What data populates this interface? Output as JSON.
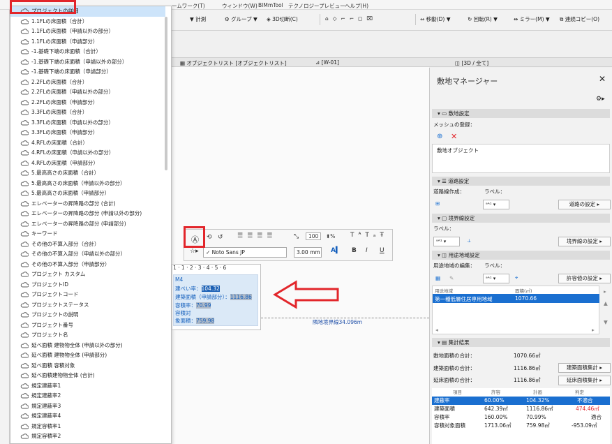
{
  "menu": {
    "items": [
      "ームワーク(T)",
      "ウィンドウ(W)",
      "BIMmTool",
      "テクノロジープレビュー",
      "ヘルプ(H)"
    ]
  },
  "toolbar": {
    "calc": "計測",
    "group": "グループ",
    "view3d": "3D切断(C)",
    "move": "移動(D)",
    "rotate": "回転(R)",
    "mirror": "ミラー(M)",
    "multi_copy": "連続コピー(O)"
  },
  "tabs": {
    "object_list": "オブジェクトリスト [オブジェクトリスト]",
    "w01": "[W-01]",
    "view3d": "[3D / 全て]"
  },
  "dropdown": {
    "items": [
      "プロジェクトの詳細",
      "1.1FLの床面積（合計）",
      "1.1FLの床面積（申請以外の部分）",
      "1.1FLの床面積（申請部分）",
      "-1.基礎下端の床面積（合計）",
      "-1.基礎下端の床面積（申請以外の部分）",
      "-1.基礎下端の床面積（申請部分）",
      "2.2FLの床面積（合計）",
      "2.2FLの床面積（申請以外の部分）",
      "2.2FLの床面積（申請部分）",
      "3.3FLの床面積（合計）",
      "3.3FLの床面積（申請以外の部分）",
      "3.3FLの床面積（申請部分）",
      "4.RFLの床面積（合計）",
      "4.RFLの床面積（申請以外の部分）",
      "4.RFLの床面積（申請部分）",
      "5.最高高さの床面積（合計）",
      "5.最高高さの床面積（申請以外の部分）",
      "5.最高高さの床面積（申請部分）",
      "エレベーターの昇降路の部分 (合計)",
      "エレベーターの昇降路の部分 (申請以外の部分)",
      "エレベーターの昇降路の部分 (申請部分)",
      "キーワード",
      "その他の不算入部分（合計）",
      "その他の不算入部分（申請以外の部分）",
      "その他の不算入部分（申請部分）",
      "プロジェクト カスタム",
      "プロジェクトID",
      "プロジェクトコード",
      "プロジェクトステータス",
      "プロジェクトの説明",
      "プロジェクト番号",
      "プロジェクト名",
      "延べ面積 建物物全体 (申請以外の部分)",
      "延べ面積 建物物全体 (申請部分)",
      "延べ面積 容積対象",
      "延べ面積建物物全体 (合計)",
      "規定建蔽率1",
      "規定建蔽率2",
      "規定建蔽率3",
      "規定建蔽率4",
      "規定容積率1",
      "規定容積率2"
    ]
  },
  "format": {
    "size": "100",
    "font": "Noto Sans JP",
    "height": "3.00",
    "unit": "mm"
  },
  "ruler": "1 · 1 · 2 · 3 · 4 · 5 · 6",
  "label": {
    "title": "M4",
    "l1_key": "建ぺい率：",
    "l1_val": "104.32",
    "l2_key": "建築面積（申請部分）：",
    "l2_val": "1116.86",
    "l3_key": "容積率：",
    "l3_val": "70.99",
    "l4": "容積対",
    "l5_key": "象面積：",
    "l5_val": "759.98"
  },
  "boundary_label": "隣地境界線34.096m",
  "manager": {
    "title": "敷地マネージャー",
    "sec_site": "敷地設定",
    "mesh_reg": "メッシュの登録：",
    "site_object": "敷地オブジェクト",
    "sec_road": "道路設定",
    "road_create": "道路線作成：",
    "label": "ラベル：",
    "road_btn": "道路の設定",
    "sec_boundary": "境界線設定",
    "boundary_btn": "境界線の設定",
    "sec_zone": "用途地域設定",
    "zone_edit": "用途地域の編集：",
    "zone_btn": "許容値の設定",
    "zone_col1": "用途地域",
    "zone_col2": "面積(㎡)",
    "zone_row_name": "第一種低層住居専用地域",
    "zone_row_area": "1070.66",
    "sec_result": "集計結果",
    "site_total_key": "敷地面積の合計：",
    "site_total_val": "1070.66㎡",
    "build_total_key": "建築面積の合計：",
    "build_total_val": "1116.86㎡",
    "build_calc_btn": "建築面積集計",
    "floor_total_key": "延床面積の合計：",
    "floor_total_val": "1116.86㎡",
    "floor_calc_btn": "延床面積集計",
    "sum_headers": [
      "項目",
      "許容",
      "計画",
      "判定"
    ],
    "sum_rows": [
      {
        "item": "建蔽率",
        "allow": "60.00%",
        "plan": "104.32%",
        "judge": "不適合"
      },
      {
        "item": "建築面積",
        "allow": "642.39㎡",
        "plan": "1116.86㎡",
        "judge": "474.46㎡"
      },
      {
        "item": "容積率",
        "allow": "160.00%",
        "plan": "70.99%",
        "judge": "適合"
      },
      {
        "item": "容積対象面積",
        "allow": "1713.06㎡",
        "plan": "759.98㎡",
        "judge": "-953.09㎡"
      }
    ]
  },
  "colors": {
    "accent_red": "#e2262b",
    "selection_blue": "#1a6fd0",
    "label_blue": "#1560bd"
  }
}
